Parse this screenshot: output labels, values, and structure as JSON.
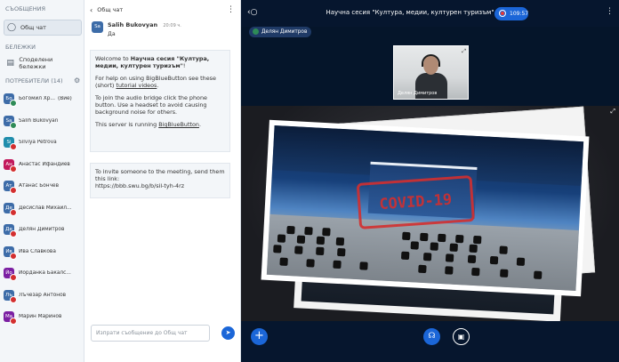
{
  "sidebar": {
    "messages_header": "СЪОБЩЕНИЯ",
    "public_chat_label": "Общ чат",
    "notes_header": "БЕЛЕЖКИ",
    "shared_notes_label": "Споделени бележки",
    "users_header": "ПОТРЕБИТЕЛИ (14)",
    "users": [
      {
        "initials": "Бо",
        "name": "Богомил Хр...",
        "suffix": "(Вие)",
        "color": "#3d6ca8",
        "status": "#2e8b57"
      },
      {
        "initials": "Sa",
        "name": "Salih Bukovyan",
        "suffix": "",
        "color": "#3d6ca8",
        "status": "#2e8b57"
      },
      {
        "initials": "Si",
        "name": "Silviya Petrova",
        "suffix": "",
        "color": "#1f8dac",
        "status": "#d32f2f"
      },
      {
        "initials": "Ан",
        "name": "Анастас Ифандиев",
        "suffix": "",
        "color": "#c2185b",
        "status": "#d32f2f"
      },
      {
        "initials": "Ат",
        "name": "Атанас Бончев",
        "suffix": "",
        "color": "#3d6ca8",
        "status": "#d32f2f"
      },
      {
        "initials": "Де",
        "name": "Десислав Михайл...",
        "suffix": "",
        "color": "#3d6ca8",
        "status": "#d32f2f"
      },
      {
        "initials": "Де",
        "name": "Делян Димитров",
        "suffix": "",
        "color": "#3d6ca8",
        "status": "#d32f2f"
      },
      {
        "initials": "Ив",
        "name": "Ива Славкова",
        "suffix": "",
        "color": "#3d6ca8",
        "status": "#d32f2f"
      },
      {
        "initials": "Йо",
        "name": "Йорданка Бакалс...",
        "suffix": "",
        "color": "#7b1fa2",
        "status": "#d32f2f"
      },
      {
        "initials": "Лъ",
        "name": "Лъчезар Антонов",
        "suffix": "",
        "color": "#3d6ca8",
        "status": "#d32f2f"
      },
      {
        "initials": "Ма",
        "name": "Марин Маринов",
        "suffix": "",
        "color": "#7b1fa2",
        "status": "#d32f2f"
      }
    ]
  },
  "chat": {
    "title": "Общ чат",
    "message": {
      "avatar": "Sa",
      "author": "Salih Bukovyan",
      "time": "20:09 ч.",
      "text": "Да"
    },
    "welcome": {
      "intro": "Welcome to",
      "session_name": "Научна сесия \"Култура, медии, културен туризъм\"",
      "bang": "!",
      "help_prefix": "For help on using BigBlueButton see these (short) ",
      "help_link": "tutorial videos",
      "help_suffix": ".",
      "audio_text": "To join the audio bridge click the phone button. Use a headset to avoid causing background noise for others.",
      "server_prefix": "This server is running ",
      "server_link": "BigBlueButton",
      "server_suffix": "."
    },
    "invite_text": "To invite someone to the meeting, send them this link:",
    "invite_link": "https://bbb.swu.bg/b/sil-tyh-4rz",
    "input_placeholder": "Изпрати съобщение до Общ чат"
  },
  "main": {
    "meeting_title": "Научна сесия \"Култура, медии, културен туризъм\"",
    "recording_time": "109:57",
    "presenter_name": "Делян Димитров",
    "webcam_label": "Делян Димитров",
    "stamp_text": "COVID-19"
  },
  "colors": {
    "accent": "#1b66d8",
    "main_bg": "#06162e",
    "stamp": "#d32f2f"
  }
}
